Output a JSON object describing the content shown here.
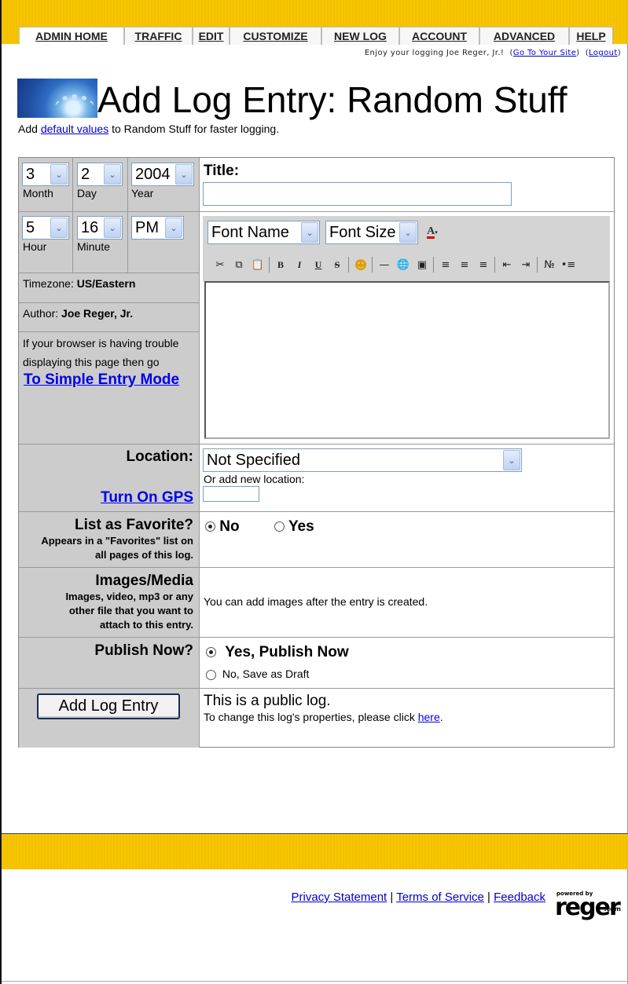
{
  "nav": {
    "tabs": [
      {
        "label": "ADMIN HOME"
      },
      {
        "label": "TRAFFIC"
      },
      {
        "label": "EDIT"
      },
      {
        "label": "CUSTOMIZE"
      },
      {
        "label": "NEW LOG"
      },
      {
        "label": "ACCOUNT"
      },
      {
        "label": "ADVANCED"
      },
      {
        "label": "HELP"
      }
    ],
    "greeting": "Enjoy your logging Joe Reger, Jr.!",
    "go_to_site": "Go To Your Site",
    "logout": "Logout"
  },
  "header": {
    "title": "Add Log Entry: Random Stuff",
    "subtitle_prefix": "Add",
    "subtitle_link": "default values",
    "subtitle_suffix": "to Random Stuff for faster logging."
  },
  "date": {
    "month": "3",
    "month_label": "Month",
    "day": "2",
    "day_label": "Day",
    "year": "2004",
    "year_label": "Year",
    "hour": "5",
    "hour_label": "Hour",
    "minute": "16",
    "minute_label": "Minute",
    "ampm": "PM"
  },
  "info": {
    "timezone_label": "Timezone:",
    "timezone_value": "US/Eastern",
    "author_label": "Author:",
    "author_value": "Joe Reger, Jr.",
    "trouble_text": "If your browser is having trouble displaying this page then go",
    "simple_mode_link": "To Simple Entry Mode"
  },
  "entry": {
    "title_label": "Title:",
    "title_value": "",
    "font_name": "Font Name",
    "font_size": "Font Size"
  },
  "location": {
    "label": "Location:",
    "gps_link": "Turn On GPS",
    "value": "Not Specified",
    "new_label": "Or add new location:",
    "new_value": ""
  },
  "favorite": {
    "label": "List as Favorite?",
    "help": "Appears in a \"Favorites\" list on all pages of this log.",
    "no": "No",
    "yes": "Yes"
  },
  "media": {
    "label": "Images/Media",
    "help": "Images, video, mp3 or any other file that you want to attach to this entry.",
    "note": "You can add images after the entry is created."
  },
  "publish": {
    "label": "Publish Now?",
    "yes": "Yes, Publish Now",
    "no": "No, Save as Draft"
  },
  "submit": {
    "button": "Add Log Entry",
    "public_text": "This is a public log.",
    "change_prefix": "To change this log's properties, please click",
    "change_link": "here"
  },
  "footer": {
    "privacy": "Privacy Statement",
    "terms": "Terms of Service",
    "feedback": "Feedback",
    "powered_by": "powered by",
    "brand": "reger",
    "brand_suffix": ".com"
  },
  "colors": {
    "band": "#f6c600",
    "grey_cell": "#cccccc",
    "link": "#0000ee"
  }
}
